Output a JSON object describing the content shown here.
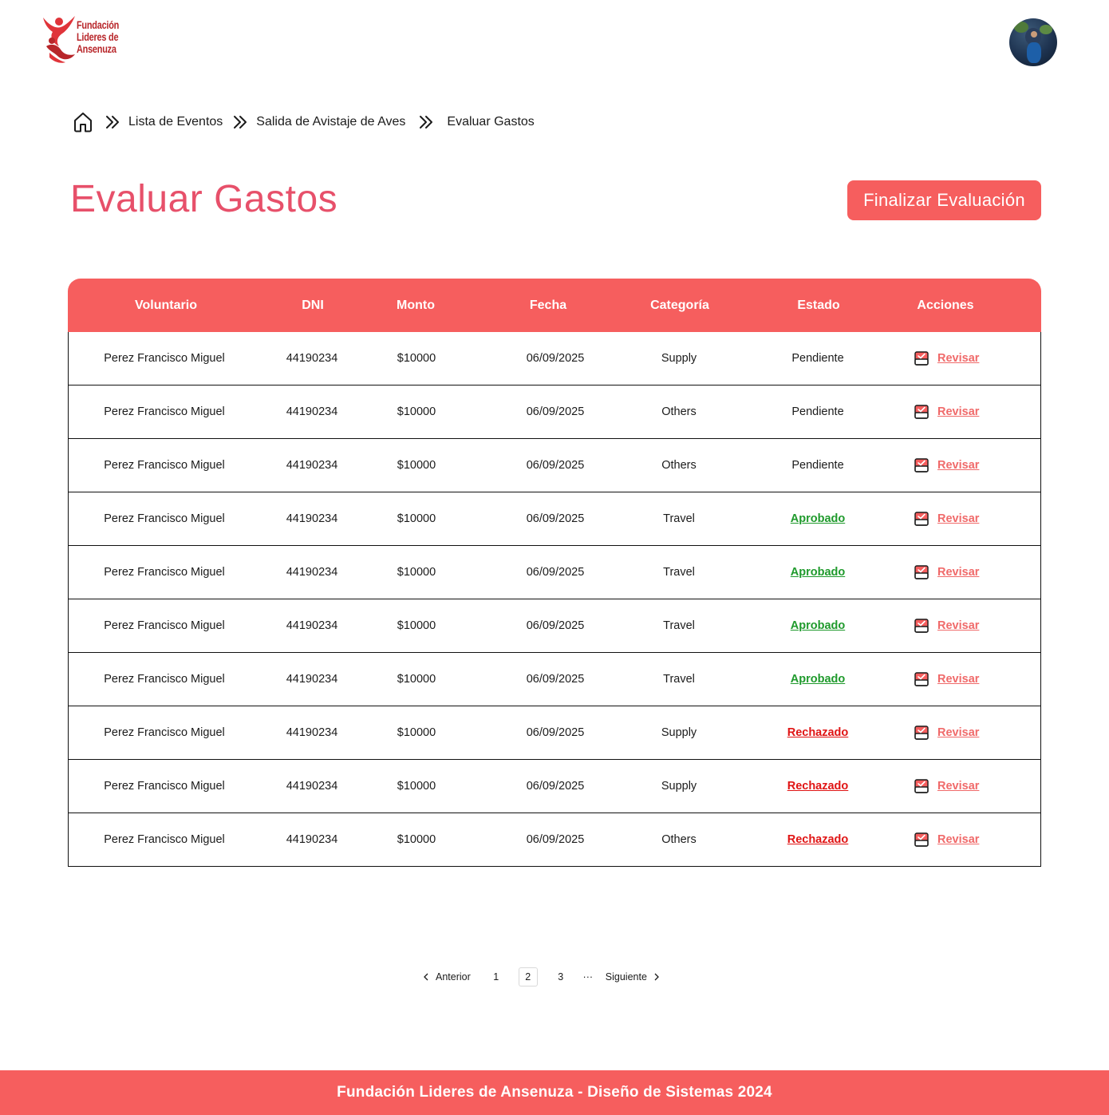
{
  "brand": {
    "logo_lines": [
      "Fundación",
      "Lideres de",
      "Ansenuza"
    ]
  },
  "breadcrumb": {
    "home_icon": "home-icon",
    "separator_icon": "double-chevron-right-icon",
    "items": [
      "Lista de Eventos",
      "Salida de Avistaje de Aves",
      "Evaluar Gastos"
    ]
  },
  "page": {
    "title": "Evaluar Gastos",
    "finish_button": "Finalizar Evaluación"
  },
  "table": {
    "columns": [
      "Voluntario",
      "DNI",
      "Monto",
      "Fecha",
      "Categoría",
      "Estado",
      "Acciones"
    ],
    "action_label": "Revisar",
    "action_icon": "checkbox-calendar-icon",
    "rows": [
      {
        "voluntario": "Perez Francisco Miguel",
        "dni": "44190234",
        "monto": "$10000",
        "fecha": "06/09/2025",
        "categoria": "Supply",
        "estado": "Pendiente"
      },
      {
        "voluntario": "Perez Francisco Miguel",
        "dni": "44190234",
        "monto": "$10000",
        "fecha": "06/09/2025",
        "categoria": "Others",
        "estado": "Pendiente"
      },
      {
        "voluntario": "Perez Francisco Miguel",
        "dni": "44190234",
        "monto": "$10000",
        "fecha": "06/09/2025",
        "categoria": "Others",
        "estado": "Pendiente"
      },
      {
        "voluntario": "Perez Francisco Miguel",
        "dni": "44190234",
        "monto": "$10000",
        "fecha": "06/09/2025",
        "categoria": "Travel",
        "estado": "Aprobado"
      },
      {
        "voluntario": "Perez Francisco Miguel",
        "dni": "44190234",
        "monto": "$10000",
        "fecha": "06/09/2025",
        "categoria": "Travel",
        "estado": "Aprobado"
      },
      {
        "voluntario": "Perez Francisco Miguel",
        "dni": "44190234",
        "monto": "$10000",
        "fecha": "06/09/2025",
        "categoria": "Travel",
        "estado": "Aprobado"
      },
      {
        "voluntario": "Perez Francisco Miguel",
        "dni": "44190234",
        "monto": "$10000",
        "fecha": "06/09/2025",
        "categoria": "Travel",
        "estado": "Aprobado"
      },
      {
        "voluntario": "Perez Francisco Miguel",
        "dni": "44190234",
        "monto": "$10000",
        "fecha": "06/09/2025",
        "categoria": "Supply",
        "estado": "Rechazado"
      },
      {
        "voluntario": "Perez Francisco Miguel",
        "dni": "44190234",
        "monto": "$10000",
        "fecha": "06/09/2025",
        "categoria": "Supply",
        "estado": "Rechazado"
      },
      {
        "voluntario": "Perez Francisco Miguel",
        "dni": "44190234",
        "monto": "$10000",
        "fecha": "06/09/2025",
        "categoria": "Others",
        "estado": "Rechazado"
      }
    ]
  },
  "pagination": {
    "prev_label": "Anterior",
    "next_label": "Siguiente",
    "pages": [
      "1",
      "2",
      "3"
    ],
    "current_page": "2",
    "ellipsis": "···"
  },
  "footer": {
    "text": "Fundación Lideres de Ansenuza - Diseño de Sistemas 2024"
  },
  "colors": {
    "accent": "#f65e5e",
    "title": "#e7506a",
    "approved": "#1f9a2c",
    "rejected": "#e01414",
    "action_link": "#f06a6a"
  }
}
